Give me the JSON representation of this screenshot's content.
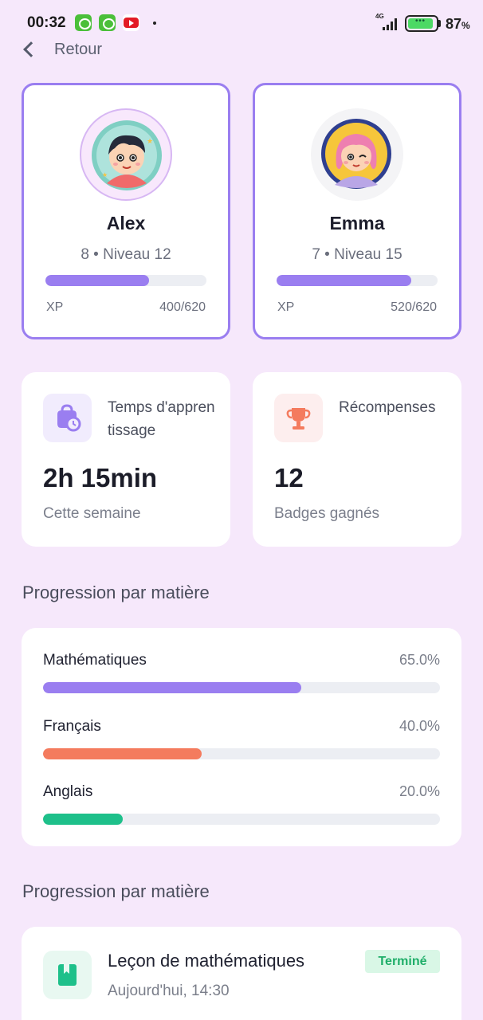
{
  "status_bar": {
    "time": "00:32",
    "network": "4G",
    "battery_percent_label": "87",
    "battery_percent_sign": "%",
    "battery_level": 0.87,
    "app_icons": [
      "android-app-icon",
      "android-app-icon",
      "youtube-icon"
    ]
  },
  "nav": {
    "back_label": "Retour"
  },
  "children": [
    {
      "name": "Alex",
      "level_text": "8 • Niveau 12",
      "xp_label": "XP",
      "xp_text": "400/620",
      "xp_current": 400,
      "xp_max": 620,
      "selected": true
    },
    {
      "name": "Emma",
      "level_text": "7 • Niveau 15",
      "xp_label": "XP",
      "xp_text": "520/620",
      "xp_current": 520,
      "xp_max": 620,
      "selected": true
    }
  ],
  "stats": {
    "learning_time": {
      "title": "Temps d'apprentissage",
      "value": "2h 15min",
      "subtitle": "Cette semaine",
      "icon": "clock-bag-icon"
    },
    "rewards": {
      "title": "Récompenses",
      "value": "12",
      "subtitle": "Badges gagnés",
      "icon": "trophy-icon"
    }
  },
  "subjects_section": {
    "title": "Progression par matière",
    "subjects": [
      {
        "name": "Mathématiques",
        "percent_text": "65.0%",
        "percent": 65.0,
        "color": "#9a7ef0"
      },
      {
        "name": "Français",
        "percent_text": "40.0%",
        "percent": 40.0,
        "color": "#f47b5e"
      },
      {
        "name": "Anglais",
        "percent_text": "20.0%",
        "percent": 20.0,
        "color": "#1ec08a"
      }
    ]
  },
  "activity_section": {
    "title": "Progression par matière",
    "items": [
      {
        "title": "Leçon de mathématiques",
        "time": "Aujourd'hui, 14:30",
        "status": "Terminé",
        "icon": "book-icon"
      }
    ]
  },
  "colors": {
    "background": "#f6e8fb",
    "accent": "#9a7ef0",
    "success": "#1fae69"
  }
}
